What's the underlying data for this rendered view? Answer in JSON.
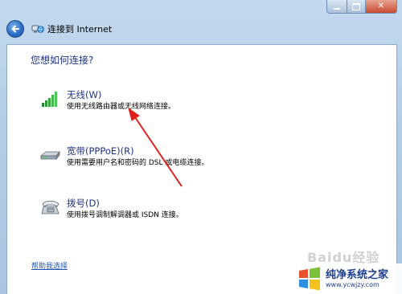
{
  "window": {
    "title": "连接到 Internet",
    "caption": {
      "minimize": "minimize-icon",
      "maximize": "maximize-icon",
      "close": "close-icon",
      "close_glyph": "✕"
    }
  },
  "page": {
    "heading": "您想如何连接?",
    "options": [
      {
        "title": "无线(W)",
        "description": "使用无线路由器或无线网络连接。",
        "icon": "wireless-signal-icon"
      },
      {
        "title": "宽带(PPPoE)(R)",
        "description": "使用需要用户名和密码的 DSL 或电缆连接。",
        "icon": "broadband-modem-icon"
      },
      {
        "title": "拨号(D)",
        "description": "使用拨号调制解调器或 ISDN 连接。",
        "icon": "dialup-phone-icon"
      }
    ],
    "help_link": "帮助我选择"
  },
  "overlays": {
    "annotation_arrow_color": "#e0201a",
    "watermark_text": "Baidu经验",
    "site_logo": {
      "title": "纯净系统之家",
      "url": "www.ycwjzy.com"
    }
  },
  "colors": {
    "heading": "#1e3287",
    "link": "#1e55b0",
    "frame": "#b3cde6",
    "close_button": "#c74a30"
  }
}
